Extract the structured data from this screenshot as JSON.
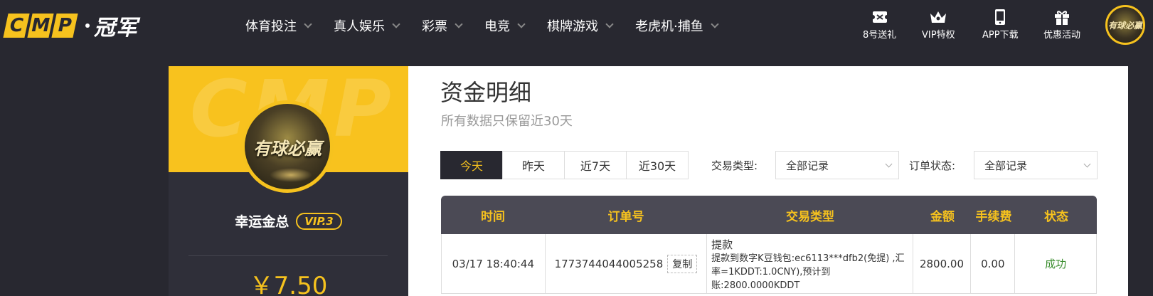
{
  "logo": {
    "letters": [
      "C",
      "M",
      "P"
    ],
    "cn_text": "冠军"
  },
  "nav": [
    {
      "label": "体育投注"
    },
    {
      "label": "真人娱乐"
    },
    {
      "label": "彩票"
    },
    {
      "label": "电竞"
    },
    {
      "label": "棋牌游戏"
    },
    {
      "label": "老虎机·捕鱼"
    }
  ],
  "quick_links": [
    {
      "label": "8号送礼",
      "icon": "ticket-icon"
    },
    {
      "label": "VIP特权",
      "icon": "crown-icon"
    },
    {
      "label": "APP下载",
      "icon": "phone-icon"
    },
    {
      "label": "优惠活动",
      "icon": "gift-icon"
    }
  ],
  "profile": {
    "avatar_slogan": "有球必赢",
    "watermark": "CMP",
    "username": "幸运金总",
    "vip": "VIP.3",
    "balance": "￥7.50"
  },
  "page": {
    "title": "资金明细",
    "subtitle": "所有数据只保留近30天"
  },
  "date_tabs": [
    {
      "label": "今天",
      "active": true
    },
    {
      "label": "昨天",
      "active": false
    },
    {
      "label": "近7天",
      "active": false
    },
    {
      "label": "近30天",
      "active": false
    }
  ],
  "filters": {
    "type_label": "交易类型:",
    "type_value": "全部记录",
    "status_label": "订单状态:",
    "status_value": "全部记录"
  },
  "table": {
    "headers": [
      "时间",
      "订单号",
      "交易类型",
      "金额",
      "手续费",
      "状态"
    ],
    "rows": [
      {
        "time": "03/17 18:40:44",
        "order_no": "1773744044005258",
        "copy_label": "复制",
        "type": "提款",
        "type_detail": "提款到数字K豆钱包:ec6113***dfb2(免提) ,汇率=1KDDT:1.0CNY),预计到账:2800.0000KDDT",
        "amount": "2800.00",
        "fee": "0.00",
        "status": "成功"
      }
    ]
  },
  "colors": {
    "accent": "#f6c21e",
    "nav_bg": "#282830",
    "header_bg": "#4b4a55",
    "success": "#3a8d2e"
  }
}
